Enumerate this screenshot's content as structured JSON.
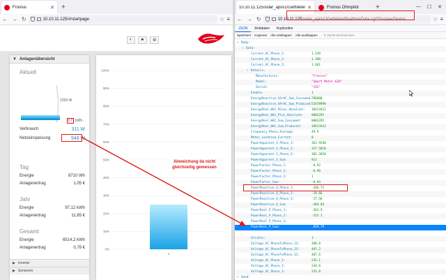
{
  "left_window": {
    "tab_title": "Fronius",
    "url": "10.10.11.125/#/startpage",
    "toolbar_buttons": [
      "◐",
      "⚑",
      "⚙"
    ],
    "panel_title": "Anlagenübersicht",
    "aktuell": {
      "title": "Aktuell",
      "power_label": "1259 W",
      "kwh_value": "3,71",
      "kwh_unit": "kWh",
      "verbrauch_label": "Verbrauch",
      "verbrauch_value": "311",
      "verbrauch_unit": "W",
      "netz_label": "Netzeinspeisung",
      "netz_value": "948",
      "netz_unit": "W"
    },
    "tag": {
      "title": "Tag",
      "energie_label": "Energie",
      "energie_value": "8710 Wh",
      "ertrag_label": "Anlagenertrag",
      "ertrag_value": "1,05 €"
    },
    "jahr": {
      "title": "Jahr",
      "energie_label": "Energie",
      "energie_value": "97,12 kWh",
      "ertrag_label": "Anlagenertrag",
      "ertrag_value": "11,65 €"
    },
    "gesamt": {
      "title": "Gesamt",
      "energie_label": "Energie",
      "energie_value": "6514,2 kWh",
      "ertrag_label": "Anlagenertrag",
      "ertrag_value": "0,78 €"
    },
    "accordion": [
      "Inverter",
      "Sensoren"
    ],
    "annotation": "Abweichung da nicht gleichzeitig gemessen"
  },
  "right_window": {
    "tab_title": "10.10.11.125/solar_api/v1/GetMeter",
    "tab2_title": "Fronius Ohmpilot",
    "url_host": "10.10.11.125",
    "url_rest": "/solar_api/v1/GetMeterRealtimeData.cgi?Scope=Device",
    "view_tabs": [
      "JSON",
      "Rohdaten",
      "Kopfzeilen"
    ],
    "tools": [
      "Speichern",
      "Kopieren",
      "Alle einklappen",
      "Alle ausklappen"
    ],
    "filter_placeholder": "JSON durchsuchen",
    "json_rows": [
      {
        "indent": 0,
        "key": "Body:",
        "value": "",
        "type": "obj"
      },
      {
        "indent": 1,
        "key": "Data:",
        "value": "",
        "type": "obj"
      },
      {
        "indent": 2,
        "key": "Current_AC_Phase_1:",
        "value": "1.549",
        "type": "num"
      },
      {
        "indent": 2,
        "key": "Current_AC_Phase_2:",
        "value": "1.396",
        "type": "num"
      },
      {
        "indent": 2,
        "key": "Current_AC_Phase_3:",
        "value": "1.661",
        "type": "num"
      },
      {
        "indent": 2,
        "key": "Details:",
        "value": "",
        "type": "obj"
      },
      {
        "indent": 3,
        "key": "Manufacturer:",
        "value": "\"Fronius\"",
        "type": "str"
      },
      {
        "indent": 3,
        "key": "Model:",
        "value": "\"Smart Meter 63A\"",
        "type": "str"
      },
      {
        "indent": 3,
        "key": "Serial:",
        "value": "\"193\"",
        "type": "str"
      },
      {
        "indent": 2,
        "key": "Enable:",
        "value": "1",
        "type": "num"
      },
      {
        "indent": 2,
        "key": "EnergyReactive_VArAC_Sum_Consumed:",
        "value": "786000",
        "type": "num"
      },
      {
        "indent": 2,
        "key": "EnergyReactive_VArAC_Sum_Produced:",
        "value": "52678990",
        "type": "num"
      },
      {
        "indent": 2,
        "key": "EnergyReal_WAC_Minus_Absolute:",
        "value": "18413412",
        "type": "num"
      },
      {
        "indent": 2,
        "key": "EnergyReal_WAC_Plus_Absolute:",
        "value": "8003295",
        "type": "num"
      },
      {
        "indent": 2,
        "key": "EnergyReal_WAC_Sum_Consumed:",
        "value": "8003295",
        "type": "num"
      },
      {
        "indent": 2,
        "key": "EnergyReal_WAC_Sum_Produced:",
        "value": "18413412",
        "type": "num"
      },
      {
        "indent": 2,
        "key": "Frequency_Phase_Average:",
        "value": "49.9",
        "type": "num"
      },
      {
        "indent": 2,
        "key": "Meter_Location_Current:",
        "value": "0",
        "type": "num"
      },
      {
        "indent": 2,
        "key": "PowerApparent_S_Phase_1:",
        "value": "363.9340",
        "type": "num"
      },
      {
        "indent": 2,
        "key": "PowerApparent_S_Phase_2:",
        "value": "327.5810",
        "type": "num"
      },
      {
        "indent": 2,
        "key": "PowerApparent_S_Phase_3:",
        "value": "381.2820",
        "type": "num"
      },
      {
        "indent": 2,
        "key": "PowerApparent_S_Sum:",
        "value": "811",
        "type": "num"
      },
      {
        "indent": 2,
        "key": "PowerFactor_Phase_1:",
        "value": "-0.92",
        "type": "num"
      },
      {
        "indent": 2,
        "key": "PowerFactor_Phase_2:",
        "value": "-0.96",
        "type": "num"
      },
      {
        "indent": 2,
        "key": "PowerFactor_Phase_3:",
        "value": "1",
        "type": "num"
      },
      {
        "indent": 2,
        "key": "PowerFactor_Sum:",
        "value": "-0.94",
        "type": "num"
      },
      {
        "indent": 2,
        "key": "PowerReactive_Q_Phase_1:",
        "value": "-266.71",
        "type": "num"
      },
      {
        "indent": 2,
        "key": "PowerReactive_Q_Phase_2:",
        "value": "-19.66",
        "type": "num"
      },
      {
        "indent": 2,
        "key": "PowerReactive_Q_Phase_3:",
        "value": "-17.56",
        "type": "num"
      },
      {
        "indent": 2,
        "key": "PowerReactive_Q_Sum:",
        "value": "-304.04",
        "type": "num"
      },
      {
        "indent": 2,
        "key": "PowerReal_P_Phase_1:",
        "value": "-363.9",
        "type": "num"
      },
      {
        "indent": 2,
        "key": "PowerReal_P_Phase_2:",
        "value": "-315.1",
        "type": "num"
      },
      {
        "indent": 2,
        "key": "PowerReal_P_Phase_3:",
        "value": "",
        "type": "num"
      },
      {
        "indent": 2,
        "key": "PowerReal_P_Sum:",
        "value": "-859.79",
        "type": "num",
        "selected": true
      },
      {
        "indent": 2,
        "key": "",
        "value": "",
        "type": "num"
      },
      {
        "indent": 2,
        "key": "Visible:",
        "value": "1",
        "type": "num"
      },
      {
        "indent": 2,
        "key": "Voltage_AC_PhaseToPhase_12:",
        "value": "400.8",
        "type": "num"
      },
      {
        "indent": 2,
        "key": "Voltage_AC_PhaseToPhase_23:",
        "value": "407.2",
        "type": "num"
      },
      {
        "indent": 2,
        "key": "Voltage_AC_PhaseToPhase_31:",
        "value": "407.6",
        "type": "num"
      },
      {
        "indent": 2,
        "key": "Voltage_AC_Phase_1:",
        "value": "235.1",
        "type": "num"
      },
      {
        "indent": 2,
        "key": "Voltage_AC_Phase_2:",
        "value": "234.6",
        "type": "num"
      },
      {
        "indent": 2,
        "key": "Voltage_AC_Phase_3:",
        "value": "235.8",
        "type": "num"
      },
      {
        "indent": 0,
        "key": "Head:",
        "value": "",
        "type": "obj"
      }
    ]
  },
  "chart_data": {
    "type": "bar",
    "y_ticks": [
      "100%",
      "90%",
      "80%",
      "70%",
      "60%",
      "50%",
      "40%",
      "30%",
      "20%",
      "10%",
      "0%"
    ],
    "categories": [
      "1"
    ],
    "values": [
      25
    ],
    "ylim": [
      0,
      100
    ],
    "bar_color": "#4fc3f7"
  },
  "colors": {
    "fronius_red": "#e2001a",
    "annotation_red": "#dd1a1a",
    "accent_blue": "#0a84ff"
  }
}
